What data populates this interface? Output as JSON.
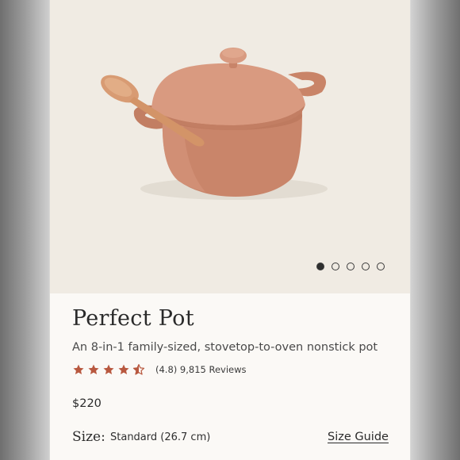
{
  "product": {
    "title": "Perfect Pot",
    "subtitle": "An 8-in-1 family-sized, stovetop-to-oven nonstick pot",
    "rating": 4.8,
    "rating_text": "(4.8) 9,815 Reviews",
    "price": "$220",
    "size_label": "Size:",
    "size_value": "Standard (26.7 cm)",
    "size_guide_label": "Size Guide"
  },
  "carousel": {
    "slide_count": 5,
    "active_index": 0,
    "image_icon": "pot-with-spoon-image"
  },
  "colors": {
    "star": "#b8583f",
    "pot": "#d28e74",
    "background": "#f4f0ea"
  }
}
